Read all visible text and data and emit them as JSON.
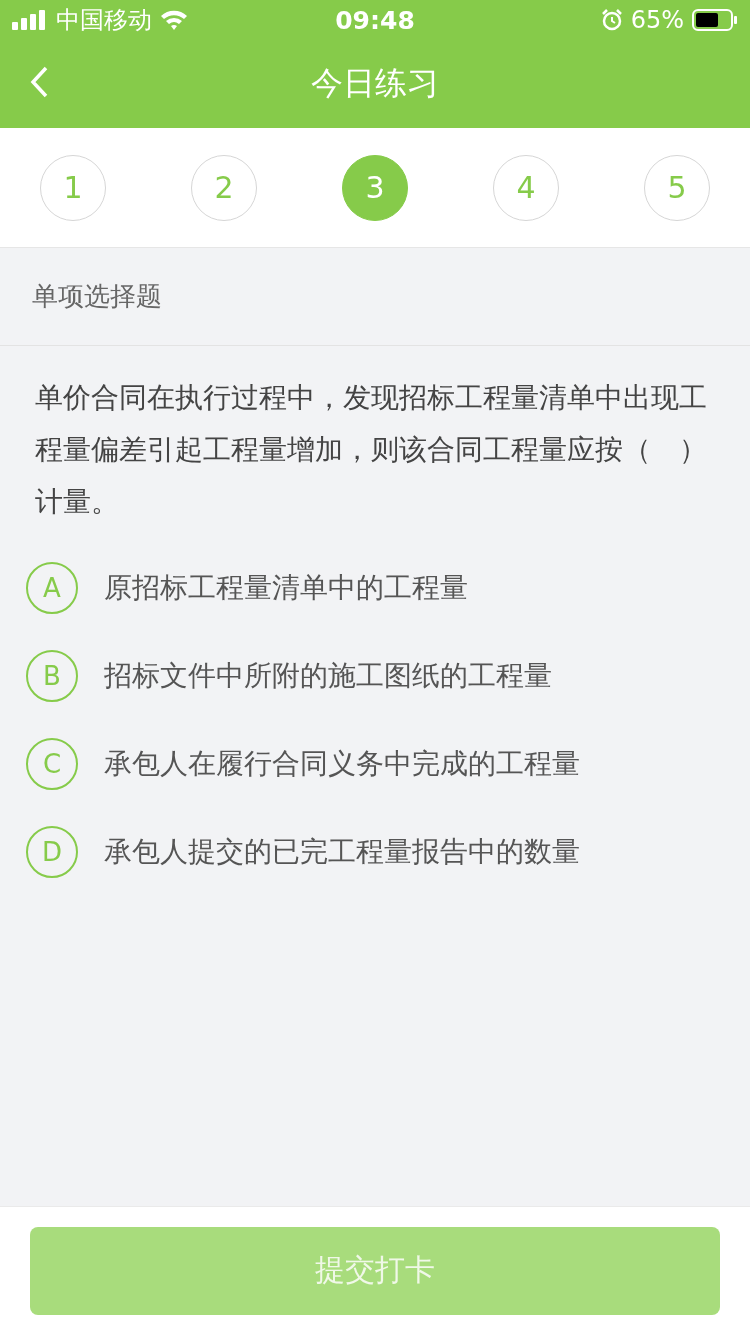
{
  "status_bar": {
    "carrier": "中国移动",
    "time": "09:48",
    "battery": "65%"
  },
  "nav": {
    "title": "今日练习"
  },
  "steps": [
    {
      "label": "1",
      "selected": false
    },
    {
      "label": "2",
      "selected": false
    },
    {
      "label": "3",
      "selected": true
    },
    {
      "label": "4",
      "selected": false
    },
    {
      "label": "5",
      "selected": false
    }
  ],
  "section": {
    "title": "单项选择题"
  },
  "question": "单价合同在执行过程中，发现招标工程量清单中出现工程量偏差引起工程量增加，则该合同工程量应按（　）计量。",
  "options": [
    {
      "letter": "A",
      "text": "原招标工程量清单中的工程量",
      "selected": false
    },
    {
      "letter": "B",
      "text": "招标文件中所附的施工图纸的工程量",
      "selected": false
    },
    {
      "letter": "C",
      "text": "承包人在履行合同义务中完成的工程量",
      "selected": false
    },
    {
      "letter": "D",
      "text": "承包人提交的已完工程量报告中的数量",
      "selected": false
    }
  ],
  "submit": {
    "label": "提交打卡",
    "disabled": true
  }
}
